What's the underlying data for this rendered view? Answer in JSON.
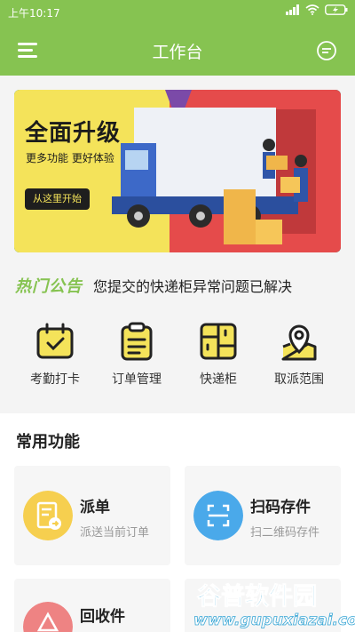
{
  "status_bar": {
    "time": "上午10:17",
    "icons": [
      "signal-icon",
      "wifi-icon",
      "battery-icon"
    ]
  },
  "header": {
    "title": "工作台",
    "left_icon": "menu-icon",
    "right_icon": "chat-icon"
  },
  "banner": {
    "headline": "全面升级",
    "subtitle": "更多功能 更好体验",
    "cta": "从这里开始"
  },
  "notice": {
    "tag": "热门公告",
    "text": "您提交的快递柜异常问题已解决"
  },
  "quick_actions": [
    {
      "label": "考勤打卡",
      "icon": "calendar-check-icon"
    },
    {
      "label": "订单管理",
      "icon": "clipboard-icon"
    },
    {
      "label": "快递柜",
      "icon": "locker-icon"
    },
    {
      "label": "取派范围",
      "icon": "map-pin-icon"
    }
  ],
  "common_functions": {
    "title": "常用功能",
    "cards": [
      {
        "title": "派单",
        "subtitle": "派送当前订单",
        "icon": "dispatch-icon"
      },
      {
        "title": "扫码存件",
        "subtitle": "扫二维码存件",
        "icon": "scan-icon"
      },
      {
        "title": "回收件",
        "subtitle": "",
        "icon": "recycle-icon"
      }
    ]
  },
  "watermark": {
    "brand": "谷普软件园",
    "url": "www.gupuxiazai.com"
  },
  "colors": {
    "primary": "#86c351",
    "banner_bg": "#2a9c8d",
    "card_bg": "#f6f6f6"
  }
}
